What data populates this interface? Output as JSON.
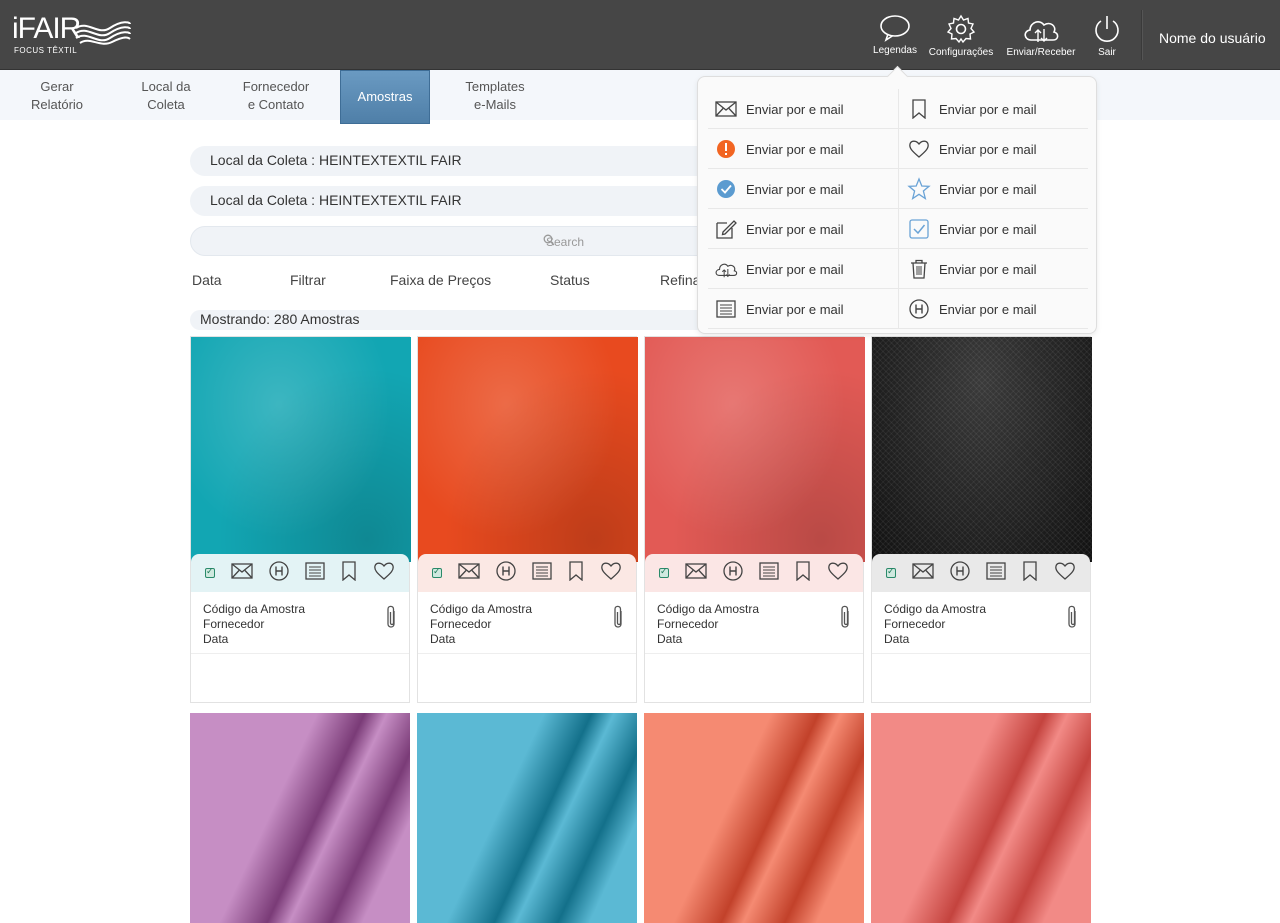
{
  "app": {
    "logo_text": "iFAIR",
    "logo_sub": "FOCUS TÊXTIL",
    "tools": [
      {
        "label": "Legendas",
        "icon": "speech-bubble-icon"
      },
      {
        "label": "Configurações",
        "icon": "gear-icon"
      },
      {
        "label": "Enviar/Receber",
        "icon": "cloud-sync-icon"
      },
      {
        "label": "Sair",
        "icon": "power-icon"
      }
    ],
    "username": "Nome do usuário"
  },
  "nav": [
    {
      "line1": "Gerar",
      "line2": "Relatório"
    },
    {
      "line1": "Local da",
      "line2": "Coleta"
    },
    {
      "line1": "Fornecedor",
      "line2": "e Contato"
    },
    {
      "line1": "Amostras",
      "line2": ""
    },
    {
      "line1": "Templates",
      "line2": "e-Mails"
    }
  ],
  "filters": {
    "local1": "Local da Coleta :  HEINTEXTEXTIL FAIR",
    "local2": "Local da Coleta :  HEINTEXTEXTIL FAIR",
    "search_placeholder": "Search",
    "tabs": [
      "Data",
      "Filtrar",
      "Faixa de Preços",
      "Status",
      "Refinar"
    ],
    "count": "Mostrando: 280 Amostras"
  },
  "legend": {
    "items": [
      {
        "icon": "envelope-icon",
        "label": "Enviar por e mail"
      },
      {
        "icon": "bookmark-icon",
        "label": "Enviar por e mail"
      },
      {
        "icon": "alert-icon",
        "label": "Enviar por e mail"
      },
      {
        "icon": "heart-icon",
        "label": "Enviar por e mail"
      },
      {
        "icon": "check-circle-icon",
        "label": "Enviar por e mail"
      },
      {
        "icon": "star-icon",
        "label": "Enviar por e mail"
      },
      {
        "icon": "edit-icon",
        "label": "Enviar por e mail"
      },
      {
        "icon": "checkbox-icon",
        "label": "Enviar por e mail"
      },
      {
        "icon": "cloud-sync-icon",
        "label": "Enviar por e mail"
      },
      {
        "icon": "trash-icon",
        "label": "Enviar por e mail"
      },
      {
        "icon": "list-icon",
        "label": "Enviar por e mail"
      },
      {
        "icon": "hotel-h-icon",
        "label": "Enviar por e mail"
      }
    ]
  },
  "samples": [
    {
      "color": "#12a6b3",
      "action_bg": "#e3f3f5",
      "code": "Código da Amostra",
      "supplier": "Fornecedor",
      "date": "Data"
    },
    {
      "color": "#e84a1f",
      "action_bg": "#fbe8e4",
      "code": "Código da Amostra",
      "supplier": "Fornecedor",
      "date": "Data"
    },
    {
      "color": "#e25a55",
      "action_bg": "#fbe6e5",
      "code": "Código da Amostra",
      "supplier": "Fornecedor",
      "date": "Data"
    },
    {
      "color": "#1e1e1e",
      "action_bg": "#e9e9e9",
      "code": "Código da Amostra",
      "supplier": "Fornecedor",
      "date": "Data"
    }
  ],
  "samples_row2": [
    {
      "color": "#c68ec4",
      "dark": "#7a3b77"
    },
    {
      "color": "#5bb9d4",
      "dark": "#13708a"
    },
    {
      "color": "#f58a72",
      "dark": "#c2412a"
    },
    {
      "color": "#f28a86",
      "dark": "#c4433e"
    }
  ]
}
